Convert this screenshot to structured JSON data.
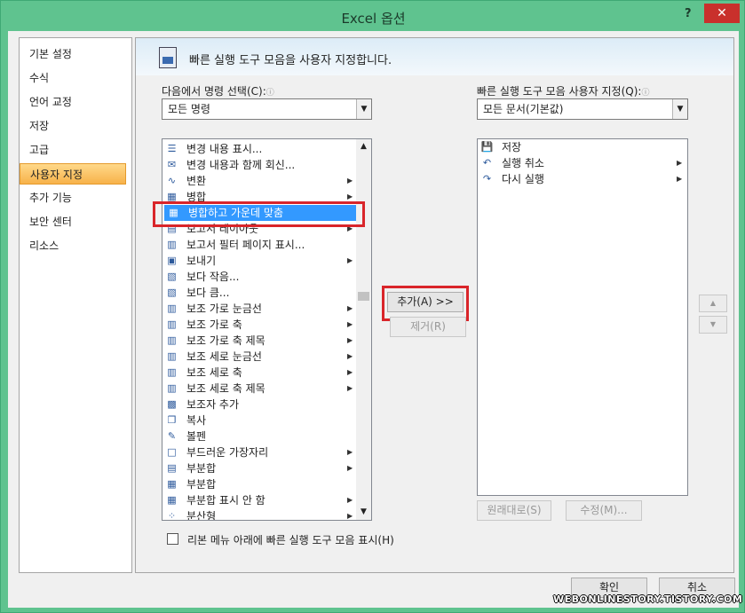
{
  "window": {
    "title": "Excel 옵션",
    "help": "?",
    "close": "✕"
  },
  "nav": [
    {
      "label": "기본 설정",
      "active": false
    },
    {
      "label": "수식",
      "active": false
    },
    {
      "label": "언어 교정",
      "active": false
    },
    {
      "label": "저장",
      "active": false
    },
    {
      "label": "고급",
      "active": false
    },
    {
      "label": "사용자 지정",
      "active": true
    },
    {
      "label": "추가 기능",
      "active": false
    },
    {
      "label": "보안 센터",
      "active": false
    },
    {
      "label": "리소스",
      "active": false
    }
  ],
  "header": {
    "text": "빠른 실행 도구 모음을 사용자 지정합니다.",
    "icon": "customize-toolbar-icon"
  },
  "left": {
    "label": "다음에서 명령 선택(C):",
    "info_icon": "ⓘ",
    "combo_value": "모든 명령",
    "commands": [
      {
        "label": "변경 내용 표시...",
        "icon": "☰",
        "submenu": false
      },
      {
        "label": "변경 내용과 함께 회신...",
        "icon": "✉",
        "submenu": false
      },
      {
        "label": "변환",
        "icon": "∿",
        "submenu": true
      },
      {
        "label": "병합",
        "icon": "▦",
        "submenu": true
      },
      {
        "label": "병합하고 가운데 맞춤",
        "icon": "▦",
        "submenu": false,
        "selected": true
      },
      {
        "label": "보고서 레이아웃",
        "icon": "▤",
        "submenu": true
      },
      {
        "label": "보고서 필터 페이지 표시...",
        "icon": "▥",
        "submenu": false
      },
      {
        "label": "보내기",
        "icon": "▣",
        "submenu": true
      },
      {
        "label": "보다 작음...",
        "icon": "▧",
        "submenu": false
      },
      {
        "label": "보다 큼...",
        "icon": "▧",
        "submenu": false
      },
      {
        "label": "보조 가로 눈금선",
        "icon": "▥",
        "submenu": true
      },
      {
        "label": "보조 가로 축",
        "icon": "▥",
        "submenu": true
      },
      {
        "label": "보조 가로 축 제목",
        "icon": "▥",
        "submenu": true
      },
      {
        "label": "보조 세로 눈금선",
        "icon": "▥",
        "submenu": true
      },
      {
        "label": "보조 세로 축",
        "icon": "▥",
        "submenu": true
      },
      {
        "label": "보조 세로 축 제목",
        "icon": "▥",
        "submenu": true
      },
      {
        "label": "보조자 추가",
        "icon": "▩",
        "submenu": false
      },
      {
        "label": "복사",
        "icon": "❐",
        "submenu": false
      },
      {
        "label": "볼펜",
        "icon": "✎",
        "submenu": false
      },
      {
        "label": "부드러운 가장자리",
        "icon": "□",
        "submenu": true
      },
      {
        "label": "부분합",
        "icon": "▤",
        "submenu": true
      },
      {
        "label": "부분합",
        "icon": "▦",
        "submenu": false
      },
      {
        "label": "부분합 표시 안 함",
        "icon": "▦",
        "submenu": true
      },
      {
        "label": "분산형",
        "icon": "⁘",
        "submenu": true
      }
    ]
  },
  "right": {
    "label": "빠른 실행 도구 모음 사용자 지정(Q):",
    "info_icon": "ⓘ",
    "combo_value": "모든 문서(기본값)",
    "items": [
      {
        "label": "저장",
        "icon": "💾",
        "submenu": false
      },
      {
        "label": "실행 취소",
        "icon": "↶",
        "submenu": true
      },
      {
        "label": "다시 실행",
        "icon": "↷",
        "submenu": true
      }
    ]
  },
  "buttons": {
    "add": "추가(A) >>",
    "remove": "제거(R)",
    "reset": "원래대로(S)",
    "modify": "수정(M)...",
    "ok": "확인",
    "cancel": "취소",
    "move_up": "▲",
    "move_down": "▼"
  },
  "checkbox": {
    "label": "리본 메뉴 아래에 빠른 실행 도구 모음 표시(H)",
    "checked": false
  },
  "watermark": "WEBONLINESTORY.TISTORY.COM",
  "colors": {
    "frame": "#5fc38f",
    "selection": "#3399ff",
    "highlight": "#d9252a",
    "active_nav": "#f7b24a"
  }
}
